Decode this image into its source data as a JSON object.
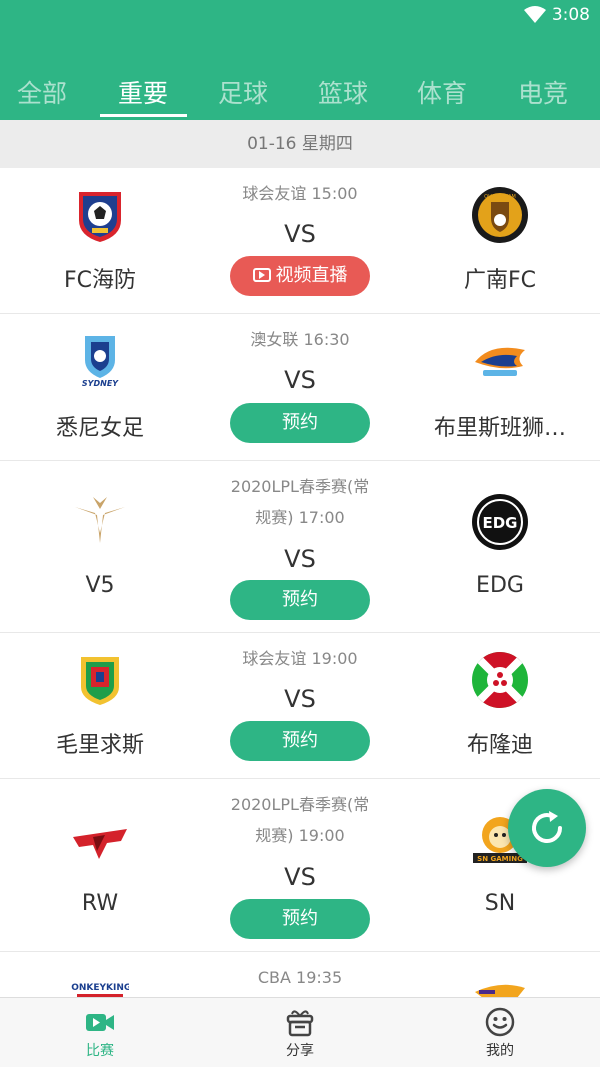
{
  "status": {
    "time": "3:08"
  },
  "tabs": [
    {
      "label": "全部"
    },
    {
      "label": "重要"
    },
    {
      "label": "足球"
    },
    {
      "label": "篮球"
    },
    {
      "label": "体育"
    },
    {
      "label": "电竞"
    }
  ],
  "active_tab": "重要",
  "date": "01-16 星期四",
  "matches": [
    {
      "league": "球会友谊 15:00",
      "vs": "VS",
      "home": "FC海防",
      "away": "广南FC",
      "action": "视频直播",
      "action_type": "live"
    },
    {
      "league": "澳女联 16:30",
      "vs": "VS",
      "home": "悉尼女足",
      "away": "布里斯班狮…",
      "action": "预约",
      "action_type": "book"
    },
    {
      "league_line1": "2020LPL春季赛(常",
      "league_line2": "规赛) 17:00",
      "vs": "VS",
      "home": "V5",
      "away": "EDG",
      "action": "预约",
      "action_type": "book"
    },
    {
      "league": "球会友谊 19:00",
      "vs": "VS",
      "home": "毛里求斯",
      "away": "布隆迪",
      "action": "预约",
      "action_type": "book"
    },
    {
      "league_line1": "2020LPL春季赛(常",
      "league_line2": "规赛) 19:00",
      "vs": "VS",
      "home": "RW",
      "away": "SN",
      "action": "预约",
      "action_type": "book"
    },
    {
      "league": "CBA 19:35"
    }
  ],
  "logo_texts": {
    "m1_away": "QUANG NAM",
    "m2_home": "SYDNEY",
    "m3_away": "EDG",
    "m5_away": "SN GAMING",
    "m6_home": "MONKEYKINGS"
  },
  "bottom_nav": [
    {
      "label": "比赛",
      "icon": "video-icon"
    },
    {
      "label": "分享",
      "icon": "gift-icon"
    },
    {
      "label": "我的",
      "icon": "smiley-icon"
    }
  ],
  "colors": {
    "primary": "#2eb585",
    "live": "#e85a55"
  }
}
